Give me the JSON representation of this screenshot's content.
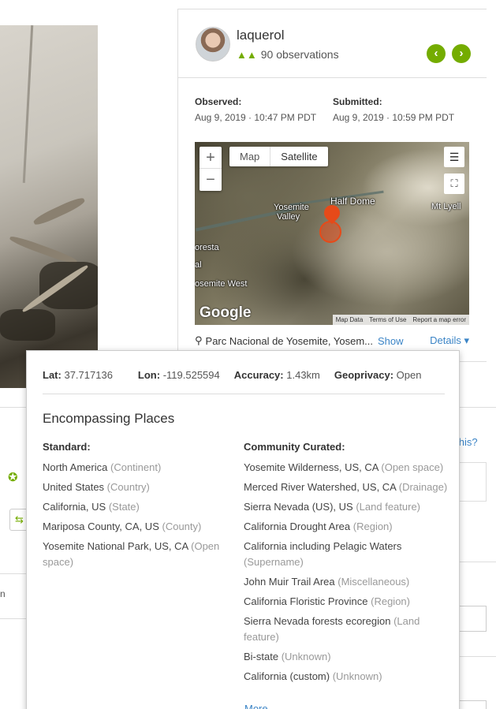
{
  "user": {
    "username": "laquerol",
    "observations": "90 observations"
  },
  "nav": {
    "prev": "‹",
    "next": "›"
  },
  "observed": {
    "label": "Observed:",
    "value": "Aug 9, 2019 · 10:47 PM PDT"
  },
  "submitted": {
    "label": "Submitted:",
    "value": "Aug 9, 2019 · 10:59 PM PDT"
  },
  "map": {
    "zoom_in": "+",
    "zoom_out": "−",
    "type_map": "Map",
    "type_satellite": "Satellite",
    "labels": {
      "half_dome": "Half Dome",
      "yosemite": "Yosemite",
      "valley": "Valley",
      "mt_lyell": "Mt Lyell",
      "foresta": "oresta",
      "al": "al",
      "yosemite_west": "osemite West"
    },
    "logo": "Google",
    "attribution": [
      "Map Data",
      "Terms of Use",
      "Report a map error"
    ]
  },
  "place": {
    "name": "Parc Nacional de Yosemite, Yosem...",
    "show": "Show",
    "details": "Details ▾"
  },
  "background": {
    "whats_this": "s this?"
  },
  "popup": {
    "lat_label": "Lat:",
    "lat": "37.717136",
    "lon_label": "Lon:",
    "lon": "-119.525594",
    "accuracy_label": "Accuracy:",
    "accuracy": "1.43km",
    "geoprivacy_label": "Geoprivacy:",
    "geoprivacy": "Open",
    "title": "Encompassing Places",
    "standard": {
      "heading": "Standard:",
      "items": [
        {
          "name": "North America",
          "type": "(Continent)"
        },
        {
          "name": "United States",
          "type": "(Country)"
        },
        {
          "name": "California, US",
          "type": "(State)"
        },
        {
          "name": "Mariposa County, CA, US",
          "type": "(County)"
        },
        {
          "name": "Yosemite National Park, US, CA",
          "type": "(Open space)"
        }
      ]
    },
    "community": {
      "heading": "Community Curated:",
      "items": [
        {
          "name": "Yosemite Wilderness, US, CA",
          "type": "(Open space)"
        },
        {
          "name": "Merced River Watershed, US, CA",
          "type": "(Drainage)"
        },
        {
          "name": "Sierra Nevada (US), US",
          "type": "(Land feature)"
        },
        {
          "name": "California Drought Area",
          "type": "(Region)"
        },
        {
          "name": "California including Pelagic Waters",
          "type": "(Supername)"
        },
        {
          "name": "John Muir Trail Area",
          "type": "(Miscellaneous)"
        },
        {
          "name": "California Floristic Province",
          "type": "(Region)"
        },
        {
          "name": "Sierra Nevada forests ecoregion",
          "type": "(Land feature)"
        },
        {
          "name": "Bi-state",
          "type": "(Unknown)"
        },
        {
          "name": "California (custom)",
          "type": "(Unknown)"
        }
      ]
    },
    "more": "More"
  }
}
